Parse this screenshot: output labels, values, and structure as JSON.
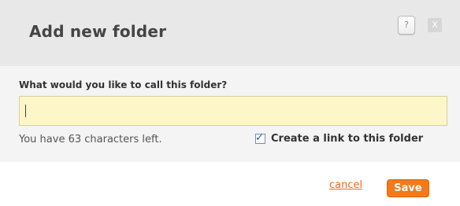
{
  "dialog": {
    "title": "Add new folder",
    "help_label": "?",
    "close_label": "X"
  },
  "form": {
    "question": "What would you like to call this folder?",
    "name_value": "",
    "chars_left": "You have 63 characters left.",
    "link_checkbox": {
      "label": "Create a link to this folder",
      "checked": true
    }
  },
  "actions": {
    "cancel_label": "cancel",
    "save_label": "Save"
  },
  "colors": {
    "header_bg": "#e8e8e8",
    "input_bg": "#fdf6c8",
    "accent": "#f07a1c"
  }
}
